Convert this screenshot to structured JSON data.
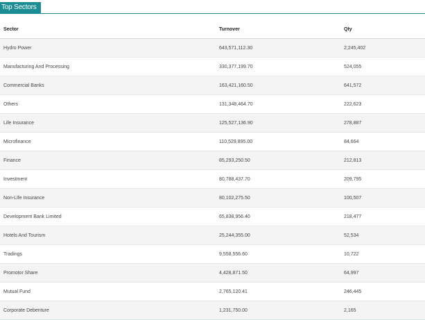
{
  "tab": {
    "title": "Top Sectors"
  },
  "table": {
    "columns": [
      "Sector",
      "Turnover",
      "Qty"
    ],
    "rows": [
      {
        "sector": "Hydro Power",
        "turnover": "643,571,112.30",
        "qty": "2,245,402"
      },
      {
        "sector": "Manufacturing And Processing",
        "turnover": "330,377,199.70",
        "qty": "524,055"
      },
      {
        "sector": "Commercial Banks",
        "turnover": "163,421,160.50",
        "qty": "641,572"
      },
      {
        "sector": "Others",
        "turnover": "131,348,464.70",
        "qty": "222,623"
      },
      {
        "sector": "Life Insurance",
        "turnover": "125,527,136.90",
        "qty": "278,887"
      },
      {
        "sector": "Microfinance",
        "turnover": "110,529,895.00",
        "qty": "84,664"
      },
      {
        "sector": "Finance",
        "turnover": "85,293,250.50",
        "qty": "212,813"
      },
      {
        "sector": "Investment",
        "turnover": "80,788,437.70",
        "qty": "209,795"
      },
      {
        "sector": "Non-Life Insurance",
        "turnover": "80,102,275.50",
        "qty": "100,507"
      },
      {
        "sector": "Development Bank Limited",
        "turnover": "65,838,956.40",
        "qty": "218,477"
      },
      {
        "sector": "Hotels And Tourism",
        "turnover": "25,244,355.00",
        "qty": "52,534"
      },
      {
        "sector": "Tradings",
        "turnover": "9,558,556.60",
        "qty": "10,722"
      },
      {
        "sector": "Promotor Share",
        "turnover": "4,428,871.50",
        "qty": "64,997"
      },
      {
        "sector": "Mutual Fund",
        "turnover": "2,765,120.41",
        "qty": "246,445"
      },
      {
        "sector": "Corporate Debenture",
        "turnover": "1,231,750.00",
        "qty": "2,165"
      }
    ]
  },
  "colors": {
    "accent": "#1c8c94",
    "row_alt": "#f4f4f4"
  }
}
